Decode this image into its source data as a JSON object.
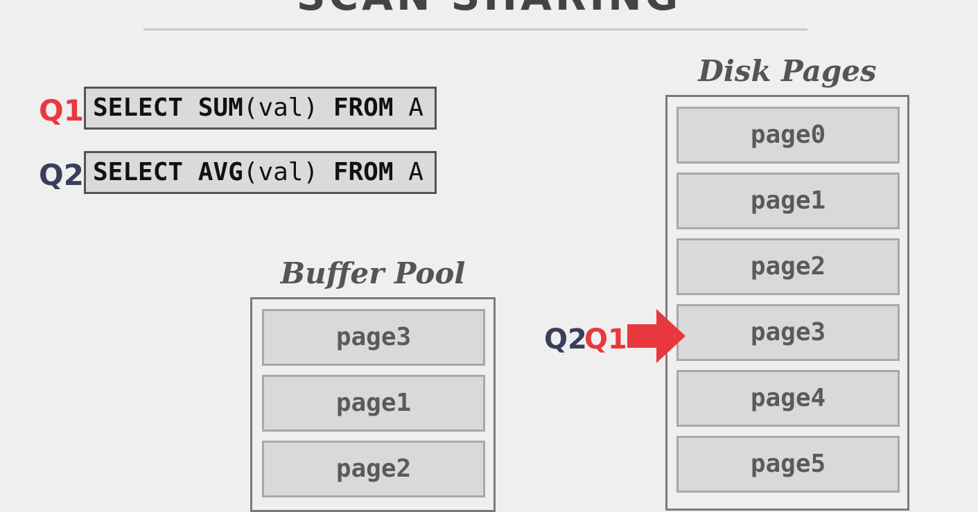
{
  "title": "SCAN SHARING",
  "queries": [
    {
      "label": "Q1",
      "keyword1": "SELECT",
      "func": "SUM",
      "args": "(val)",
      "keyword2": "FROM",
      "table": "A",
      "color": "#e8383d"
    },
    {
      "label": "Q2",
      "keyword1": "SELECT",
      "func": "AVG",
      "args": "(val)",
      "keyword2": "FROM",
      "table": "A",
      "color": "#3a3e5c"
    }
  ],
  "buffer_pool": {
    "label": "Buffer Pool",
    "pages": [
      "page3",
      "page1",
      "page2"
    ]
  },
  "disk_pages": {
    "label": "Disk Pages",
    "pages": [
      "page0",
      "page1",
      "page2",
      "page3",
      "page4",
      "page5"
    ]
  },
  "cursor": {
    "q2_label": "Q2",
    "q1_label": "Q1",
    "arrow_color": "#e8383d",
    "points_to": "page3"
  }
}
